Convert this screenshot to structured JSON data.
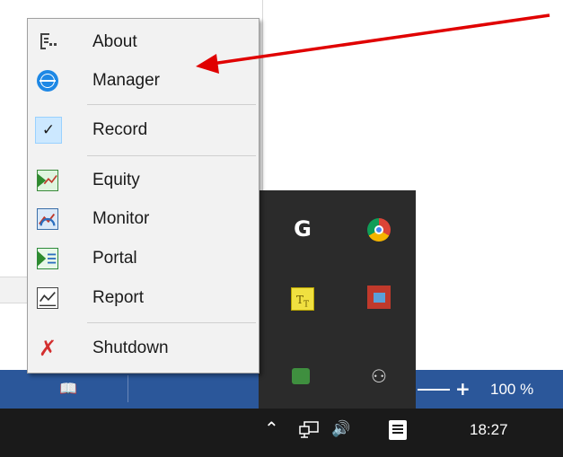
{
  "menu": {
    "items": [
      {
        "label": "About",
        "icon": "about-icon"
      },
      {
        "label": "Manager",
        "icon": "globe-icon"
      },
      {
        "label": "Record",
        "icon": "checkmark-icon",
        "checked": true
      },
      {
        "label": "Equity",
        "icon": "equity-chart-icon"
      },
      {
        "label": "Monitor",
        "icon": "monitor-chart-icon"
      },
      {
        "label": "Portal",
        "icon": "portal-icon"
      },
      {
        "label": "Report",
        "icon": "report-chart-icon"
      },
      {
        "label": "Shutdown",
        "icon": "shutdown-x-icon"
      }
    ]
  },
  "status_bar": {
    "zoom": "100 %",
    "zoom_plus": "+"
  },
  "taskbar": {
    "clock": "18:27"
  },
  "annotation": {
    "arrow_color": "#e00000"
  },
  "colors": {
    "status_bar": "#2b579a",
    "taskbar": "#1a1a1a",
    "menu_bg": "#f2f2f2",
    "check_highlight": "#cce8ff"
  }
}
